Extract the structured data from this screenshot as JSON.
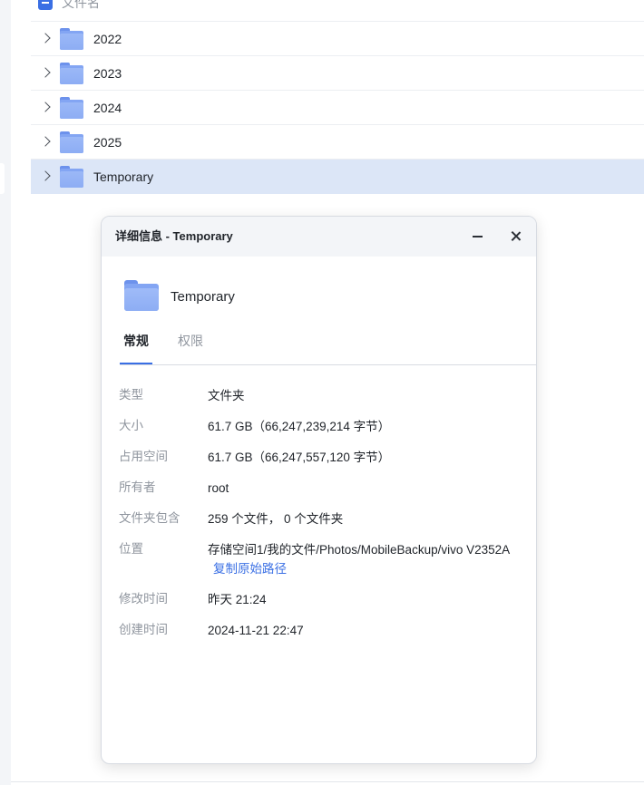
{
  "file_list": {
    "header_label": "文件名",
    "rows": [
      {
        "name": "2022",
        "selected": false
      },
      {
        "name": "2023",
        "selected": false
      },
      {
        "name": "2024",
        "selected": false
      },
      {
        "name": "2025",
        "selected": false
      },
      {
        "name": "Temporary",
        "selected": true
      }
    ]
  },
  "dialog": {
    "title": "详细信息 - Temporary",
    "item_name": "Temporary",
    "tabs": [
      {
        "label": "常规",
        "active": true
      },
      {
        "label": "权限",
        "active": false
      }
    ],
    "properties": {
      "type": {
        "label": "类型",
        "value": "文件夹"
      },
      "size": {
        "label": "大小",
        "value": "61.7 GB（66,247,239,214 字节）"
      },
      "disk_usage": {
        "label": "占用空间",
        "value": "61.7 GB（66,247,557,120 字节）"
      },
      "owner": {
        "label": "所有者",
        "value": "root"
      },
      "contains": {
        "label": "文件夹包含",
        "value": "259 个文件， 0 个文件夹"
      },
      "location": {
        "label": "位置",
        "value": "存储空间1/我的文件/Photos/MobileBackup/vivo V2352A",
        "link": "复制原始路径"
      },
      "modified": {
        "label": "修改时间",
        "value": "昨天 21:24"
      },
      "created": {
        "label": "创建时间",
        "value": "2024-11-21 22:47"
      }
    }
  },
  "colors": {
    "accent": "#3a6fe4",
    "selected_row": "#dce6f7",
    "folder": "#8dadf4",
    "muted_text": "#8f959e"
  },
  "icons": [
    "checkbox-indeterminate-icon",
    "chevron-right-icon",
    "folder-icon",
    "minimize-icon",
    "close-icon"
  ]
}
